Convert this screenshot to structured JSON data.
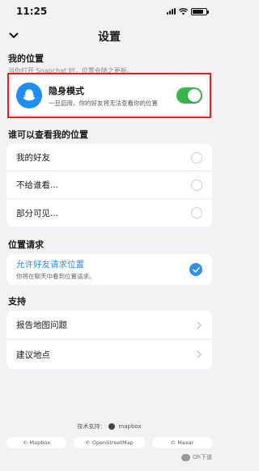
{
  "status_bar": {
    "time": "11:25"
  },
  "nav": {
    "title": "设置"
  },
  "my_location": {
    "title": "我的位置",
    "subtitle": "当你打开 Snapchat 时，位置会随之更新。",
    "ghost_mode": {
      "title": "隐身模式",
      "subtitle": "一旦启用，你的好友将无法查看你的位置",
      "enabled": true
    }
  },
  "who_can_see": {
    "title": "谁可以查看我的位置",
    "options": [
      {
        "label": "我的好友",
        "selected": false
      },
      {
        "label": "不给谁看...",
        "selected": false
      },
      {
        "label": "部分可见...",
        "selected": false
      }
    ]
  },
  "location_requests": {
    "title": "位置请求",
    "option": {
      "label": "允许好友请求位置",
      "subtitle": "你将在聊天中看到位置请求。",
      "checked": true
    }
  },
  "support": {
    "title": "支持",
    "items": [
      {
        "label": "报告地图问题"
      },
      {
        "label": "建议地点"
      }
    ]
  },
  "footer": {
    "credit": "技术支持：",
    "credit_brand": "mapbox",
    "attributions": [
      "© Mapbox",
      "© OpenStreetMap",
      "© Maxar"
    ]
  },
  "watermark": {
    "text": "Oh下道"
  },
  "colors": {
    "accent_blue": "#2f8ff0",
    "toggle_green": "#39b54a",
    "highlight_red": "#e0231c",
    "ghost_blue": "#1f8ef1"
  }
}
